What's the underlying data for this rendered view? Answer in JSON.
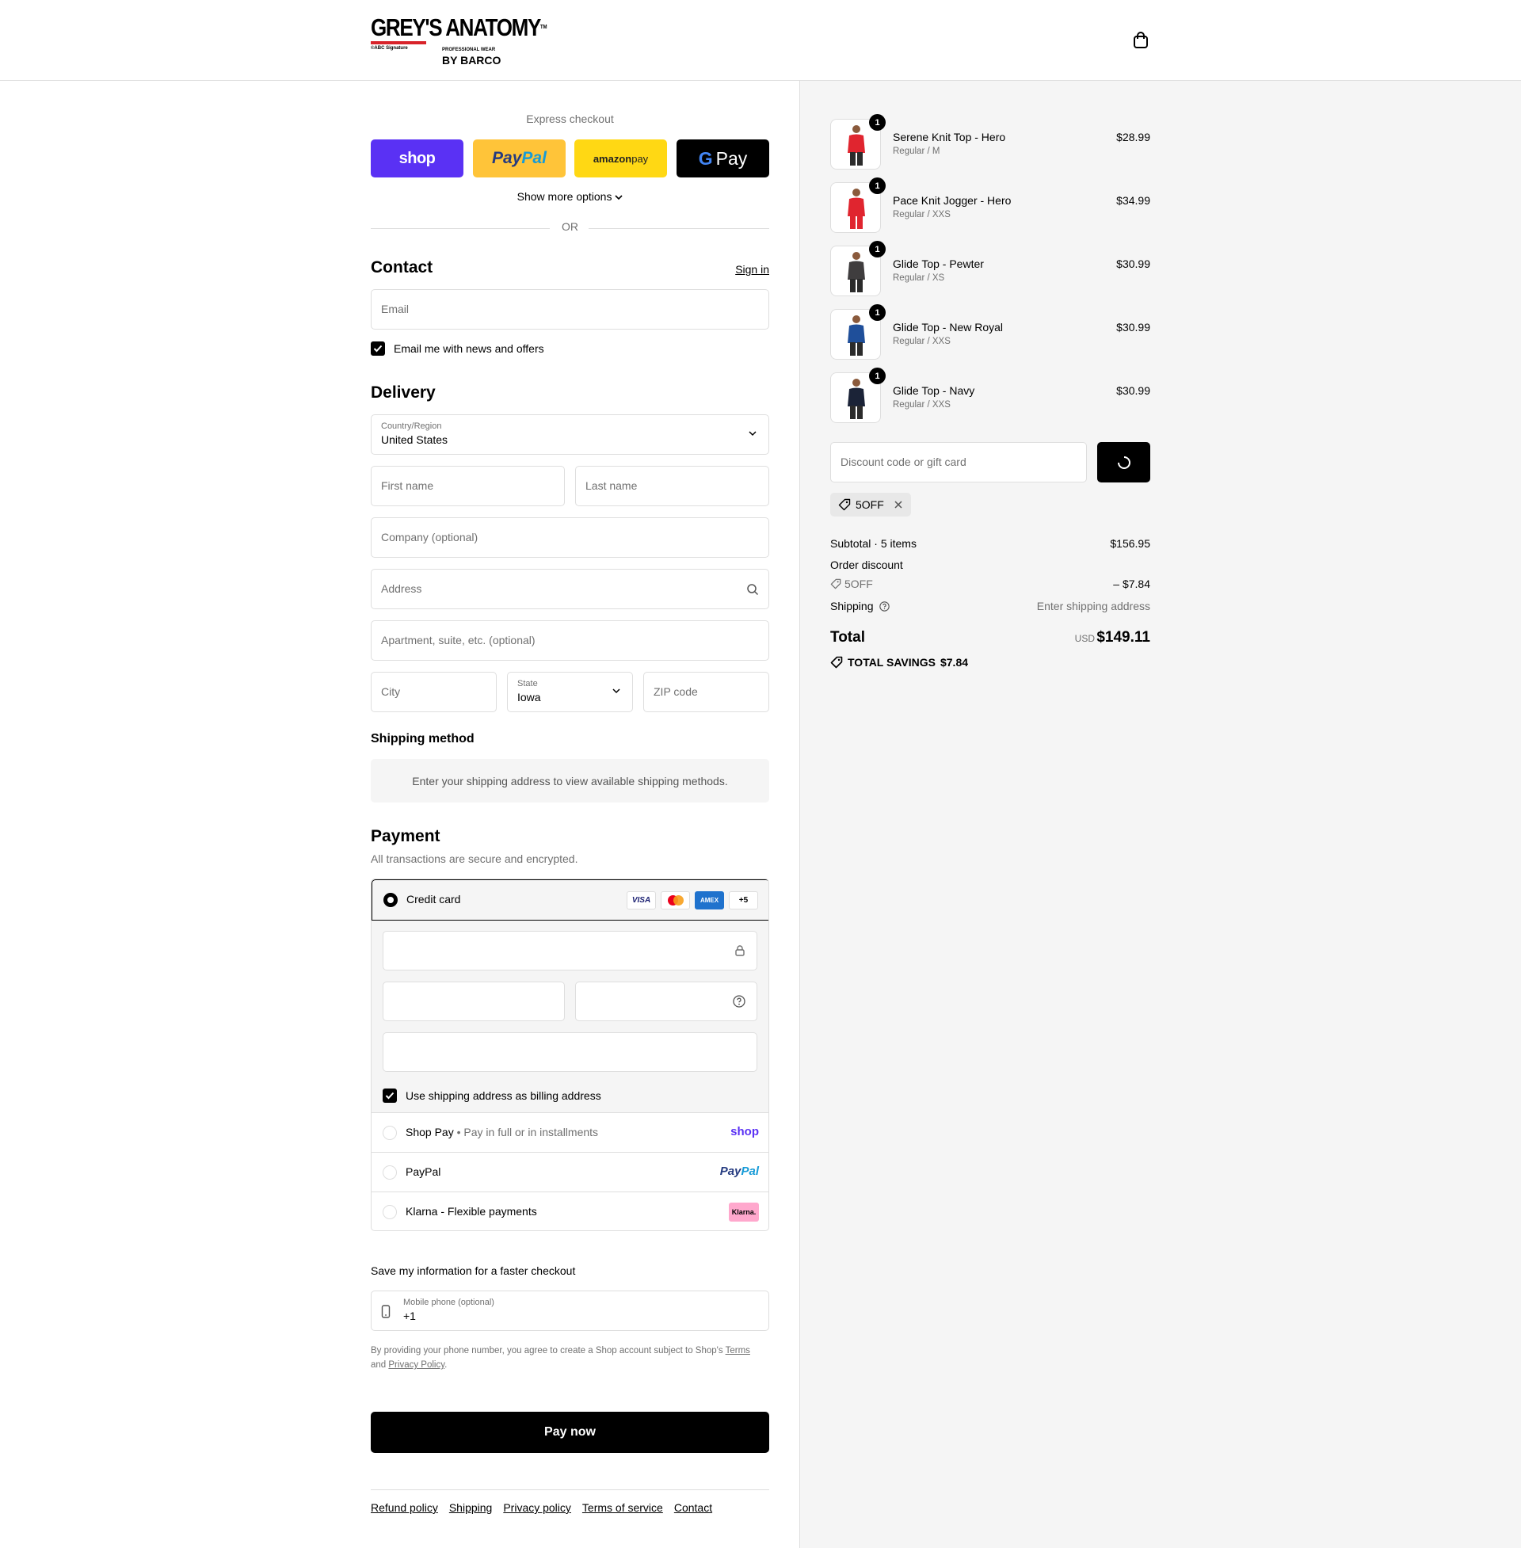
{
  "brand": {
    "logo_main": "GREY'S ANATOMY",
    "logo_tm": "TM",
    "logo_abc": "©ABC Signature",
    "logo_professional": "PROFESSIONAL WEAR",
    "logo_barco": "BY BARCO"
  },
  "express": {
    "title": "Express checkout",
    "shop_label": "shop",
    "paypal_label_1": "Pay",
    "paypal_label_2": "Pal",
    "amazon_label_1": "amazon",
    "amazon_label_2": " pay",
    "gpay_label_g": "G",
    "gpay_label": "Pay",
    "show_more": "Show more options",
    "or": "OR"
  },
  "contact": {
    "heading": "Contact",
    "sign_in": "Sign in",
    "email_placeholder": "Email",
    "newsletter_label": "Email me with news and offers",
    "newsletter_checked": true
  },
  "delivery": {
    "heading": "Delivery",
    "country_label": "Country/Region",
    "country_value": "United States",
    "first_name": "First name",
    "last_name": "Last name",
    "company": "Company (optional)",
    "address": "Address",
    "apartment": "Apartment, suite, etc. (optional)",
    "city": "City",
    "state_label": "State",
    "state_value": "Iowa",
    "zip": "ZIP code"
  },
  "shipping_method": {
    "heading": "Shipping method",
    "info": "Enter your shipping address to view available shipping methods."
  },
  "payment": {
    "heading": "Payment",
    "subtitle": "All transactions are secure and encrypted.",
    "credit_card_label": "Credit card",
    "card_brands": [
      "VISA",
      "MC",
      "AMEX",
      "+5"
    ],
    "billing_same_label": "Use shipping address as billing address",
    "shop_pay_label": "Shop Pay",
    "shop_pay_sub": "Pay in full or in installments",
    "shop_pay_brand": "shop",
    "paypal_label": "PayPal",
    "paypal_brand_1": "Pay",
    "paypal_brand_2": "Pal",
    "klarna_label": "Klarna - Flexible payments",
    "klarna_brand": "Klarna."
  },
  "save_info": {
    "title": "Save my information for a faster checkout",
    "phone_label": "Mobile phone (optional)",
    "phone_value": "+1",
    "legal_1": "By providing your phone number, you agree to create a Shop account subject to Shop's ",
    "terms": "Terms",
    "legal_2": "and ",
    "privacy": "Privacy Policy",
    "legal_3": "."
  },
  "pay_now": "Pay now",
  "footer": [
    "Refund policy",
    "Shipping",
    "Privacy policy",
    "Terms of service",
    "Contact"
  ],
  "cart": {
    "items": [
      {
        "name": "Serene Knit Top - Hero",
        "variant": "Regular / M",
        "price": "$28.99",
        "qty": "1",
        "color": "#e0252f"
      },
      {
        "name": "Pace Knit Jogger - Hero",
        "variant": "Regular / XXS",
        "price": "$34.99",
        "qty": "1",
        "color": "#e0252f"
      },
      {
        "name": "Glide Top - Pewter",
        "variant": "Regular / XS",
        "price": "$30.99",
        "qty": "1",
        "color": "#3f3d3e"
      },
      {
        "name": "Glide Top - New Royal",
        "variant": "Regular / XXS",
        "price": "$30.99",
        "qty": "1",
        "color": "#1f4f9a"
      },
      {
        "name": "Glide Top - Navy",
        "variant": "Regular / XXS",
        "price": "$30.99",
        "qty": "1",
        "color": "#1b2337"
      }
    ],
    "discount_placeholder": "Discount code or gift card",
    "applied_code": "5OFF",
    "subtotal_label": "Subtotal · 5 items",
    "subtotal_value": "$156.95",
    "order_discount_label": "Order discount",
    "discount_code": "5OFF",
    "discount_value": "– $7.84",
    "shipping_label": "Shipping",
    "shipping_value": "Enter shipping address",
    "total_label": "Total",
    "currency": "USD",
    "total_value": "$149.11",
    "savings_label": "TOTAL SAVINGS",
    "savings_value": "$7.84"
  }
}
